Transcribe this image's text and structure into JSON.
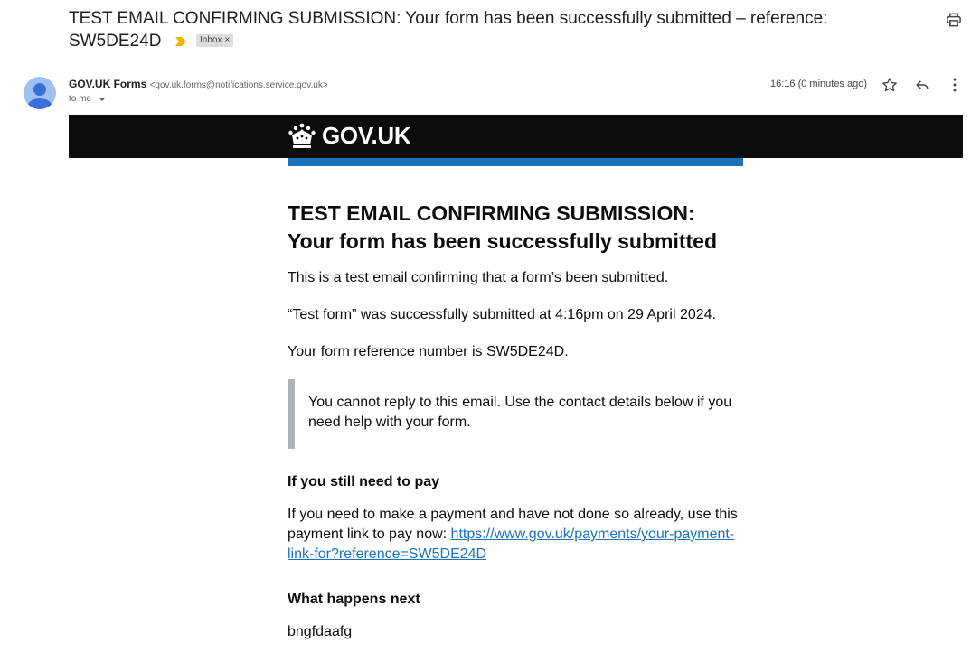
{
  "email": {
    "subject_line1": "TEST EMAIL CONFIRMING SUBMISSION: Your form has been successfully submitted – reference:",
    "subject_line2": "SW5DE24D",
    "label": "Inbox",
    "label_close": "×",
    "sender_name": "GOV.UK Forms",
    "sender_email": "<gov.uk.forms@notifications.service.gov.uk>",
    "to": "to me",
    "timestamp": "16:16 (0 minutes ago)"
  },
  "icons": {
    "print": "printer-icon",
    "star": "star-icon",
    "reply": "reply-icon",
    "more": "more-vert-icon",
    "avatar": "person-icon",
    "crown": "crown-icon"
  },
  "colors": {
    "govuk_black": "#0b0c0c",
    "govuk_blue": "#1d70b8",
    "inset_border": "#b1b4b6",
    "important_marker": "#f4b400"
  },
  "body": {
    "logo_text": "GOV.UK",
    "heading_line1": "TEST EMAIL CONFIRMING SUBMISSION:",
    "heading_line2": "Your form has been successfully submitted",
    "intro": "This is a test email confirming that a form’s been submitted.",
    "submitted": "“Test form” was successfully submitted at 4:16pm on 29 April 2024.",
    "reference": "Your form reference number is SW5DE24D.",
    "inset": "You cannot reply to this email. Use the contact details below if you need help with your form.",
    "pay_heading": "If you still need to pay",
    "pay_text": "If you need to make a payment and have not done so already, use this payment link to pay now: ",
    "pay_link": "https://www.gov.uk/payments/your-payment-link-for?reference=SW5DE24D",
    "next_heading": "What happens next",
    "next_text": "bngfdaafg"
  }
}
